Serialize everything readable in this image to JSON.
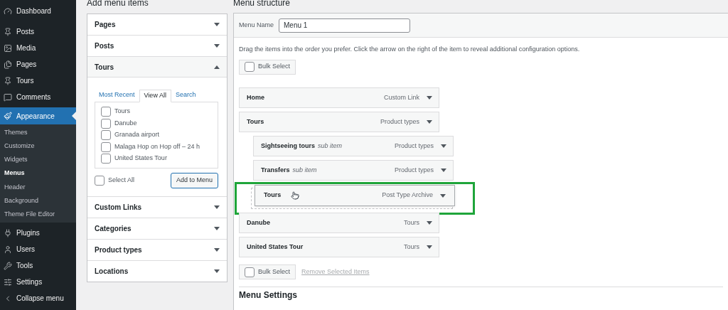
{
  "sidebar": {
    "items": [
      {
        "label": "Dashboard",
        "selected": false
      },
      {
        "label": "Posts",
        "selected": false
      },
      {
        "label": "Media",
        "selected": false
      },
      {
        "label": "Pages",
        "selected": false
      },
      {
        "label": "Tours",
        "selected": false
      },
      {
        "label": "Comments",
        "selected": false
      },
      {
        "label": "Appearance",
        "selected": true,
        "children": [
          {
            "label": "Themes",
            "selected": false
          },
          {
            "label": "Customize",
            "selected": false
          },
          {
            "label": "Widgets",
            "selected": false
          },
          {
            "label": "Menus",
            "selected": true
          },
          {
            "label": "Header",
            "selected": false
          },
          {
            "label": "Background",
            "selected": false
          },
          {
            "label": "Theme File Editor",
            "selected": false
          }
        ]
      },
      {
        "label": "Plugins",
        "selected": false
      },
      {
        "label": "Users",
        "selected": false
      },
      {
        "label": "Tools",
        "selected": false
      },
      {
        "label": "Settings",
        "selected": false
      },
      {
        "label": "Collapse menu",
        "selected": false
      }
    ]
  },
  "add_menu_items": {
    "title": "Add menu items",
    "sections": [
      {
        "title": "Pages",
        "expanded": false
      },
      {
        "title": "Posts",
        "expanded": false
      },
      {
        "title": "Tours",
        "expanded": true,
        "tabs": [
          {
            "label": "Most Recent",
            "selected": false
          },
          {
            "label": "View All",
            "selected": true
          },
          {
            "label": "Search",
            "selected": false
          }
        ],
        "items": [
          {
            "label": "Tours",
            "checked": false
          },
          {
            "label": "Danube",
            "checked": false
          },
          {
            "label": "Granada airport",
            "checked": false
          },
          {
            "label": "Malaga Hop on Hop off – 24 h",
            "checked": false
          },
          {
            "label": "United States Tour",
            "checked": false
          }
        ],
        "select_all": {
          "label": "Select All",
          "checked": false
        },
        "button": "Add to Menu"
      },
      {
        "title": "Custom Links",
        "expanded": false
      },
      {
        "title": "Categories",
        "expanded": false
      },
      {
        "title": "Product types",
        "expanded": false
      },
      {
        "title": "Locations",
        "expanded": false
      }
    ]
  },
  "menu_structure": {
    "title": "Menu structure",
    "menu_name_label": "Menu Name",
    "menu_name": "Menu 1",
    "instructions": "Drag the items into the order you prefer. Click the arrow on the right of the item to reveal additional configuration options.",
    "bulk_select_top": {
      "label": "Bulk Select",
      "checked": false
    },
    "items": [
      {
        "title": "Home",
        "type": "Custom Link",
        "dragging": false
      },
      {
        "title": "Tours",
        "type": "Product types",
        "dragging": false,
        "children": [
          {
            "title": "Sightseeing tours",
            "note": "sub item",
            "type": "Product types",
            "dragging": false
          },
          {
            "title": "Transfers",
            "note": "sub item",
            "type": "Product types",
            "dragging": false
          },
          {
            "title": "Tours",
            "type": "Post Type Archive",
            "dragging": true
          }
        ]
      },
      {
        "title": "Danube",
        "type": "Tours",
        "dragging": false
      },
      {
        "title": "United States Tour",
        "type": "Tours",
        "dragging": false
      }
    ],
    "bulk_select_bottom": {
      "label": "Bulk Select",
      "checked": false
    },
    "remove_link": "Remove Selected Items",
    "settings_title": "Menu Settings"
  }
}
